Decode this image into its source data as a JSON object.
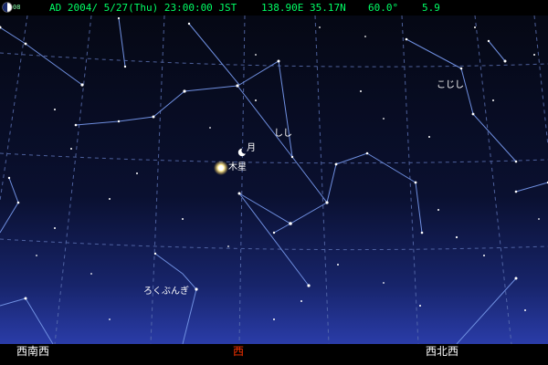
{
  "header": {
    "moon_age": "08",
    "date": "AD 2004/ 5/27(Thu) 23:00:00 JST",
    "location": "138.90E 35.17N",
    "view_angle": "60.0°",
    "limit_magnitude": "5.9"
  },
  "sky": {
    "labels": {
      "moon": "月",
      "jupiter": "木星",
      "leo": "しし",
      "leo_minor": "こじし",
      "sextans": "ろくぶんぎ"
    }
  },
  "compass": {
    "left": "西南西",
    "center": "西",
    "right": "西北西"
  },
  "colors": {
    "status_text": "#00ff66",
    "constellation_line": "#6f8fe0",
    "grid_line": "#5a6fb0",
    "compass_center": "#ff3300",
    "compass_side": "#ffffff"
  }
}
